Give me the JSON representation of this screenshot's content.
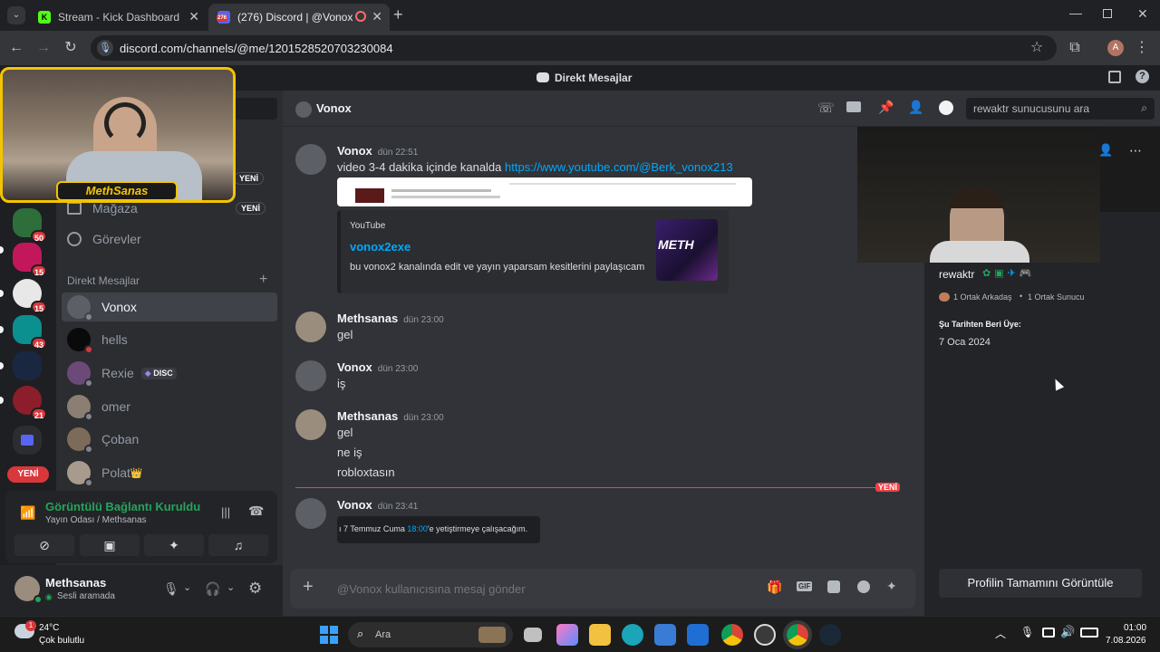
{
  "browser": {
    "tabs": [
      {
        "title": "Stream - Kick Dashboard",
        "favicon": "K"
      },
      {
        "title": "(276) Discord | @Vonox",
        "favicon": "276"
      }
    ],
    "url": "discord.com/channels/@me/1201528520703230084",
    "profile_initial": "A"
  },
  "discord": {
    "top_title": "Direkt Mesajlar",
    "rail": {
      "badges": [
        "50",
        "15",
        "15",
        "43",
        "21"
      ],
      "new_label": "YENİ"
    },
    "sidebar": {
      "items_top": [
        {
          "label": "Mağaza",
          "badge": "YENİ"
        },
        {
          "label": "Görevler"
        }
      ],
      "top_new_badge": "YENİ",
      "dm_header": "Direkt Mesajlar",
      "dm_add": "+",
      "dms": [
        {
          "name": "Vonox",
          "status": "offline",
          "active": true
        },
        {
          "name": "hells",
          "status": "dnd"
        },
        {
          "name": "Rexie",
          "status": "offline",
          "tag": "DISC"
        },
        {
          "name": "omer",
          "status": "offline"
        },
        {
          "name": "Çoban",
          "status": "offline"
        },
        {
          "name": "Polat",
          "status": "offline",
          "crown": "👑"
        }
      ]
    },
    "voice": {
      "status": "Görüntülü Bağlantı Kuruldu",
      "channel": "Yayın Odası / Methsanas"
    },
    "user": {
      "name": "Methsanas",
      "status": "Sesli aramada"
    },
    "chat": {
      "header_name": "Vonox",
      "search_placeholder": "rewaktr sunucusunu ara",
      "messages": [
        {
          "author": "Vonox",
          "time": "dün 22:51",
          "lines": [
            "video 3-4 dakika içinde kanalda "
          ],
          "link": "https://www.youtube.com/@Berk_vonox213"
        },
        {
          "author": "Methsanas",
          "time": "dün 23:00",
          "lines": [
            "gel"
          ]
        },
        {
          "author": "Vonox",
          "time": "dün 23:00",
          "lines": [
            "iş"
          ]
        },
        {
          "author": "Methsanas",
          "time": "dün 23:00",
          "lines": [
            "gel",
            "ne iş",
            "robloxtasın"
          ]
        },
        {
          "author": "Vonox",
          "time": "dün 23:41",
          "lines": []
        }
      ],
      "embed": {
        "provider": "YouTube",
        "title": "vonox2exe",
        "description": "bu vonox2 kanalında edit ve yayın yaparsam kesitlerini paylaşıcam",
        "thumb_text": "METH"
      },
      "attachment_text": {
        "prefix": "ı 7 Temmuz Cuma ",
        "time": "18:00",
        "suffix": "'e yetiştirmeye çalışacağım."
      },
      "new_divider": "YENİ",
      "composer_placeholder": "@Vonox kullanıcısına mesaj gönder"
    },
    "profile": {
      "username": "rewaktr",
      "mutual_friends": "1 Ortak Arkadaş",
      "mutual_servers": "1 Ortak Sunucu",
      "member_since_label": "Şu Tarihten Beri Üye:",
      "member_since": "7 Oca 2024",
      "full_profile_button": "Profilin Tamamını Görüntüle"
    }
  },
  "overlay": {
    "streamer_name": "MethSanas"
  },
  "taskbar": {
    "weather_temp": "24°C",
    "weather_desc": "Çok bulutlu",
    "weather_badge": "1",
    "search_label": "Ara",
    "time": "01:00",
    "date": "7.08.2026"
  },
  "colors": {
    "accent": "#5865f2",
    "link": "#00a8fc",
    "danger": "#da373c",
    "online": "#23a55a",
    "overlay_gold": "#f5c400"
  }
}
